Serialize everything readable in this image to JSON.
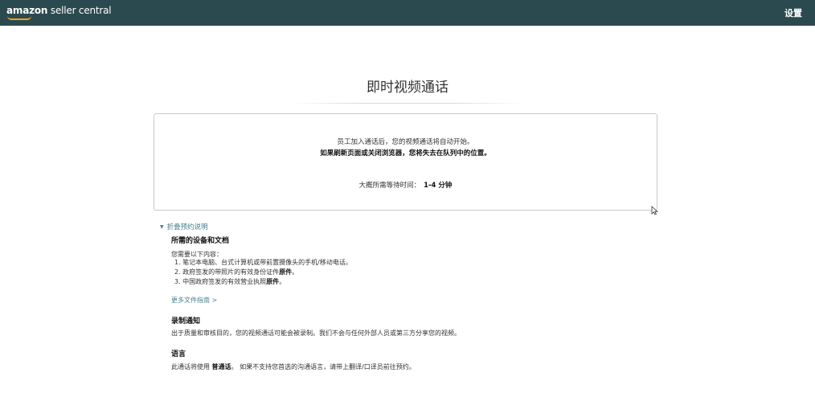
{
  "header": {
    "logo_brand": "amazon",
    "logo_rest": " seller central",
    "settings_label": "设置"
  },
  "page": {
    "title": "即时视频通话"
  },
  "status": {
    "line1": "员工加入通话后，您的视频通话将自动开始。",
    "line2": "如果刷新页面或关闭浏览器，您将失去在队列中的位置。",
    "wait_label": "大概所需等待时间：",
    "wait_value": "1-4 分钟"
  },
  "instructions": {
    "toggle_label": "折叠预约说明",
    "devices": {
      "heading": "所需的设备和文档",
      "intro": "您需要以下内容：",
      "items": [
        {
          "text": "1. 笔记本电脑、台式计算机或带前置摄像头的手机/移动电话。",
          "bold": ""
        },
        {
          "text": "2. 政府签发的带照片的有效身份证件",
          "bold": "原件",
          "end": "。"
        },
        {
          "text": "3. 中国政府签发的有效营业执照",
          "bold": "原件",
          "end": "。"
        }
      ],
      "more_link": "更多文件指南 >"
    },
    "recording": {
      "heading": "录制通知",
      "text": "出于质量和审核目的，您的视频通话可能会被录制。我们不会与任何外部人员或第三方分享您的视频。"
    },
    "language": {
      "heading": "语言",
      "text_before": "此通话将使用 ",
      "text_bold": "普通话",
      "text_after": "。 如果不支持您首选的沟通语言，请带上翻译/口译员前往预约。"
    }
  },
  "colors": {
    "topbar": "#2b4a4f",
    "accent_link": "#4a7f8c",
    "logo_smile": "#f7a21b"
  }
}
